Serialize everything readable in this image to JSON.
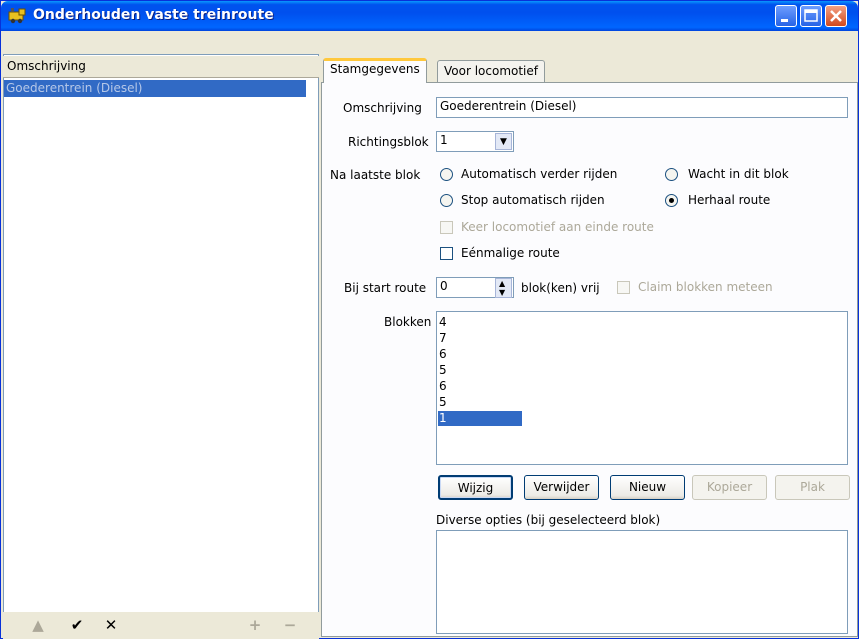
{
  "window": {
    "title": "Onderhouden vaste treinroute",
    "controls": {
      "minimize_icon": "minimize-icon",
      "maximize_icon": "maximize-icon",
      "close_icon": "close-icon"
    }
  },
  "left_pane": {
    "column_header": "Omschrijving",
    "items": [
      "Goederentrein (Diesel)"
    ],
    "toolbar": [
      "arrow-up-icon",
      "check-icon",
      "x-icon",
      "plus-icon",
      "minus-icon"
    ]
  },
  "tabs": [
    {
      "label": "Stamgegevens",
      "active": true
    },
    {
      "label": "Voor locomotief",
      "active": false
    }
  ],
  "form": {
    "omschrijving_label": "Omschrijving",
    "omschrijving_value": "Goederentrein (Diesel)",
    "richtingsblok_label": "Richtingsblok",
    "richtingsblok_value": "1",
    "na_laatste_blok_label": "Na laatste blok",
    "radio_automatisch": "Automatisch verder rijden",
    "radio_wacht": "Wacht in dit blok",
    "radio_stop": "Stop automatisch rijden",
    "radio_herhaal": "Herhaal route",
    "check_keer": "Keer locomotief aan einde route",
    "check_eenmalig": "Eénmalige route",
    "bij_start_label": "Bij start route",
    "bij_start_value": "0",
    "blok_vrij_label": "blok(ken) vrij",
    "check_claim": "Claim blokken meteen",
    "blokken_label": "Blokken",
    "blokken": [
      "4",
      "7",
      "6",
      "5",
      "6",
      "5",
      "1"
    ],
    "buttons": {
      "wijzig": "Wijzig",
      "verwijder": "Verwijder",
      "nieuw": "Nieuw",
      "kopieer": "Kopieer",
      "plak": "Plak"
    },
    "diverse_label": "Diverse opties (bij geselecteerd blok)"
  },
  "colors": {
    "selection": "#316ac5",
    "title_bar": "#0054e3",
    "face": "#ece9d8"
  }
}
